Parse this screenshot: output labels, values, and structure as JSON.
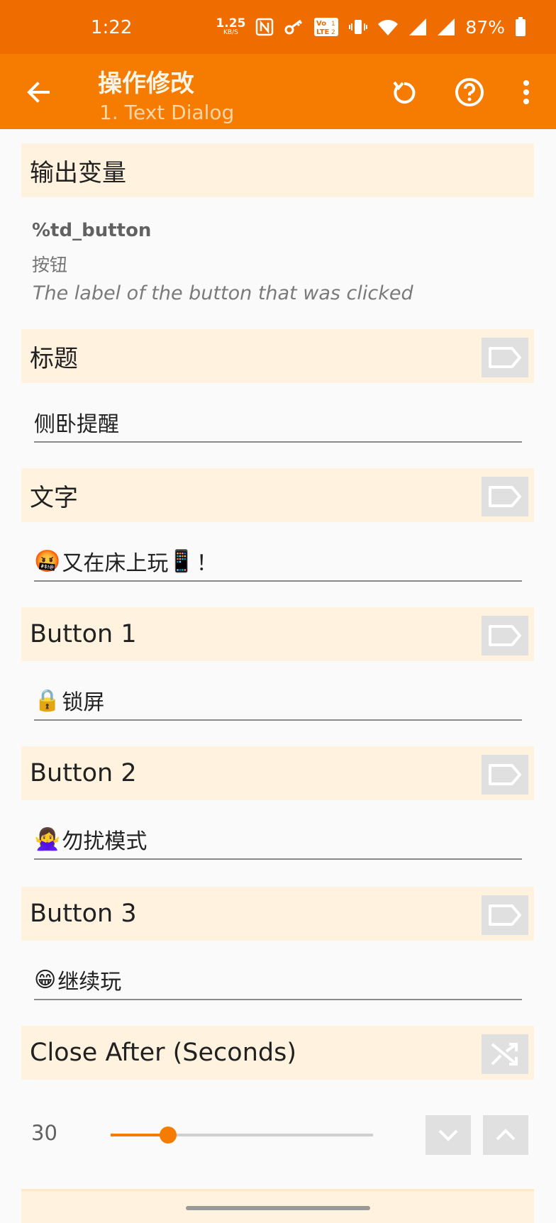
{
  "status_bar": {
    "time": "1:22",
    "net_speed_value": "1.25",
    "net_speed_unit": "KB/S",
    "battery_percent": "87%",
    "icons": [
      "nfc-icon",
      "key-icon",
      "volte-icon",
      "vibrate-icon",
      "wifi-icon",
      "signal-icon",
      "signal-icon",
      "battery-icon"
    ]
  },
  "app_bar": {
    "title": "操作修改",
    "subtitle": "1. Text Dialog",
    "icons": [
      "back-arrow-icon",
      "undo-icon",
      "help-icon",
      "more-vert-icon"
    ]
  },
  "output": {
    "header": "输出变量",
    "var_name": "%td_button",
    "var_label": "按钮",
    "var_desc": "The label of the button that was clicked"
  },
  "fields": {
    "title": {
      "label": "标题",
      "value": "侧卧提醒"
    },
    "text": {
      "label": "文字",
      "emoji_start": "🤬",
      "value": "又在床上玩",
      "emoji_end": "📱",
      "suffix": "！"
    },
    "button1": {
      "label": "Button 1",
      "emoji": "🔒",
      "value": "锁屏"
    },
    "button2": {
      "label": "Button 2",
      "emoji": "🙅‍♀️",
      "value": "勿扰模式"
    },
    "button3": {
      "label": "Button 3",
      "emoji": "😁",
      "value": "继续玩"
    }
  },
  "close_after": {
    "label": "Close After (Seconds)",
    "value": "30",
    "slider_fraction": 0.22,
    "icons": [
      "shuffle-icon",
      "chevron-down-icon",
      "chevron-up-icon"
    ]
  },
  "colors": {
    "status_bar": "#ef6c00",
    "app_bar": "#f57c00",
    "accent": "#f57c00",
    "section_bg": "#fff3e0"
  }
}
